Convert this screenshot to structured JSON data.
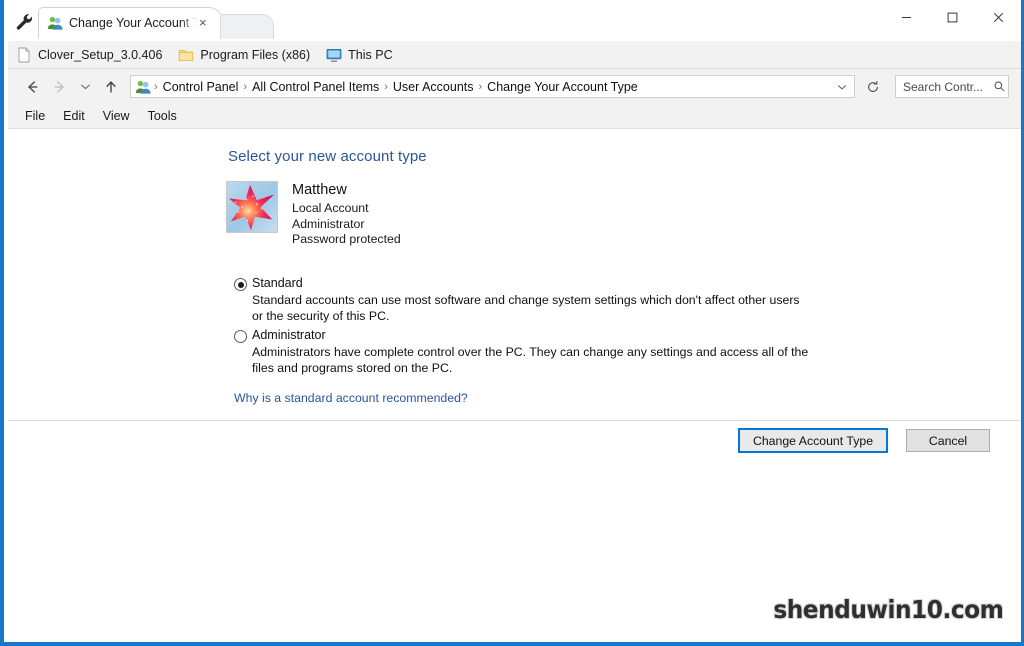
{
  "window": {
    "accent_color": "#1878c8",
    "controls": {
      "minimize": "minimize-icon",
      "maximize": "maximize-icon",
      "close": "close-icon"
    }
  },
  "tabstrip": {
    "tools_icon": "wrench-icon",
    "active_tab": {
      "icon": "user-accounts-icon",
      "title": "Change Your Account Type",
      "close_label": "×"
    },
    "new_tab_label": ""
  },
  "bookmarks": [
    {
      "label": "Clover_Setup_3.0.406",
      "icon": "file-icon"
    },
    {
      "label": "Program Files (x86)",
      "icon": "folder-icon"
    },
    {
      "label": "This PC",
      "icon": "monitor-icon"
    }
  ],
  "address_bar": {
    "back_icon": "back-arrow-icon",
    "forward_icon": "forward-arrow-icon",
    "recent_icon": "chevron-down-icon",
    "up_icon": "up-arrow-icon",
    "crumb_icon": "user-accounts-icon",
    "breadcrumbs": [
      "Control Panel",
      "All Control Panel Items",
      "User Accounts",
      "Change Your Account Type"
    ],
    "separator": "›",
    "dropdown_icon": "chevron-down-icon",
    "refresh_icon": "refresh-icon",
    "search": {
      "placeholder": "Search Contr...",
      "icon": "search-icon"
    }
  },
  "menubar": [
    "File",
    "Edit",
    "View",
    "Tools"
  ],
  "main": {
    "heading": "Select your new account type",
    "heading_color": "#2a5699",
    "user": {
      "avatar_alt": "starfish-avatar",
      "name": "Matthew",
      "lines": [
        "Local Account",
        "Administrator",
        "Password protected"
      ]
    },
    "options": [
      {
        "label": "Standard",
        "selected": true,
        "description": "Standard accounts can use most software and change system settings which don't affect other users or the security of this PC."
      },
      {
        "label": "Administrator",
        "selected": false,
        "description": "Administrators have complete control over the PC. They can change any settings and access all of the files and programs stored on the PC."
      }
    ],
    "help_link": "Why is a standard account recommended?",
    "buttons": {
      "primary": "Change Account Type",
      "secondary": "Cancel"
    }
  },
  "watermark": "shenduwin10.com"
}
